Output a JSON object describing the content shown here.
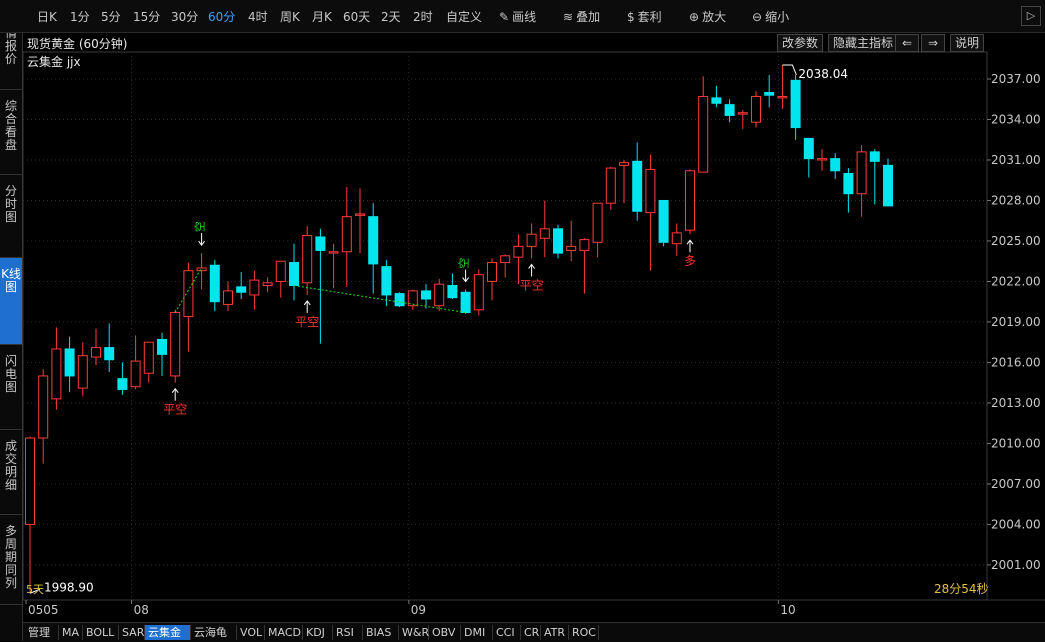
{
  "toolbar": {
    "periods": [
      "日K",
      "1分",
      "5分",
      "15分",
      "30分",
      "60分",
      "4时",
      "周K",
      "月K",
      "60天",
      "2天",
      "2时",
      "自定义"
    ],
    "active_period": "60分",
    "tools": [
      {
        "icon": "pencil-icon",
        "label": "画线"
      },
      {
        "icon": "stack-icon",
        "label": "叠加"
      },
      {
        "icon": "money-bag-icon",
        "label": "套利"
      },
      {
        "icon": "zoom-in-icon",
        "label": "放大"
      },
      {
        "icon": "zoom-out-icon",
        "label": "缩小"
      }
    ],
    "right_arrow": "▷"
  },
  "left_tabs": [
    "行情报价",
    "综合看盘",
    "分时图",
    "K线图",
    "闪电图",
    "成交明细",
    "多周期同列"
  ],
  "active_left_tab": "K线图",
  "header": {
    "title": "现货黄金 (60分钟)",
    "buttons": {
      "params": "改参数",
      "hide_indicator": "隐藏主指标",
      "prev": "⇐",
      "next": "⇒",
      "help": "说明"
    }
  },
  "indicator_title": "云集金 jjx",
  "chart_data": {
    "type": "candlestick",
    "y_ticks": [
      2037.0,
      2034.0,
      2031.0,
      2028.0,
      2025.0,
      2022.0,
      2019.0,
      2016.0,
      2013.0,
      2010.0,
      2007.0,
      2004.0,
      2001.0
    ],
    "ylim": [
      1998.4,
      2039.0
    ],
    "x_labels": [
      {
        "label": "0505",
        "i": 0
      },
      {
        "label": "08",
        "i": 8
      },
      {
        "label": "09",
        "i": 29
      },
      {
        "label": "10",
        "i": 57
      }
    ],
    "max_label": "2038.04",
    "min_label": "1998.90",
    "countdown": "28分54秒",
    "corner_label": "5天",
    "candles": [
      {
        "o": 2004.0,
        "h": 2010.5,
        "l": 1998.9,
        "c": 2010.4
      },
      {
        "o": 2010.4,
        "h": 2015.5,
        "l": 2008.5,
        "c": 2015.0
      },
      {
        "o": 2013.3,
        "h": 2018.6,
        "l": 2012.5,
        "c": 2017.0
      },
      {
        "o": 2017.0,
        "h": 2017.9,
        "l": 2013.8,
        "c": 2015.0
      },
      {
        "o": 2014.1,
        "h": 2017.5,
        "l": 2013.5,
        "c": 2016.5
      },
      {
        "o": 2016.4,
        "h": 2018.5,
        "l": 2015.8,
        "c": 2017.1
      },
      {
        "o": 2017.1,
        "h": 2018.9,
        "l": 2015.3,
        "c": 2016.2
      },
      {
        "o": 2014.8,
        "h": 2016.0,
        "l": 2013.6,
        "c": 2014.0
      },
      {
        "o": 2014.2,
        "h": 2018.0,
        "l": 2014.0,
        "c": 2016.1
      },
      {
        "o": 2015.2,
        "h": 2017.5,
        "l": 2014.5,
        "c": 2017.5
      },
      {
        "o": 2017.7,
        "h": 2018.2,
        "l": 2015.0,
        "c": 2016.6
      },
      {
        "o": 2015.0,
        "h": 2019.9,
        "l": 2014.5,
        "c": 2019.7
      },
      {
        "o": 2019.4,
        "h": 2023.4,
        "l": 2016.8,
        "c": 2022.8
      },
      {
        "o": 2022.8,
        "h": 2024.1,
        "l": 2021.4,
        "c": 2023.0
      },
      {
        "o": 2023.2,
        "h": 2023.6,
        "l": 2019.8,
        "c": 2020.5
      },
      {
        "o": 2020.3,
        "h": 2022.0,
        "l": 2019.8,
        "c": 2021.3
      },
      {
        "o": 2021.6,
        "h": 2022.7,
        "l": 2020.7,
        "c": 2021.2
      },
      {
        "o": 2021.0,
        "h": 2022.8,
        "l": 2019.9,
        "c": 2022.1
      },
      {
        "o": 2021.7,
        "h": 2022.3,
        "l": 2021.2,
        "c": 2021.9
      },
      {
        "o": 2022.0,
        "h": 2023.5,
        "l": 2020.8,
        "c": 2023.5
      },
      {
        "o": 2023.4,
        "h": 2024.8,
        "l": 2020.6,
        "c": 2021.7
      },
      {
        "o": 2021.9,
        "h": 2026.1,
        "l": 2021.0,
        "c": 2025.4
      },
      {
        "o": 2025.3,
        "h": 2025.9,
        "l": 2017.4,
        "c": 2024.3
      },
      {
        "o": 2024.1,
        "h": 2024.8,
        "l": 2021.5,
        "c": 2024.2
      },
      {
        "o": 2024.2,
        "h": 2029.0,
        "l": 2021.6,
        "c": 2026.8
      },
      {
        "o": 2026.9,
        "h": 2028.9,
        "l": 2024.1,
        "c": 2027.0
      },
      {
        "o": 2026.8,
        "h": 2027.8,
        "l": 2021.1,
        "c": 2023.3
      },
      {
        "o": 2023.1,
        "h": 2023.6,
        "l": 2020.2,
        "c": 2021.0
      },
      {
        "o": 2021.1,
        "h": 2021.2,
        "l": 2020.1,
        "c": 2020.2
      },
      {
        "o": 2020.2,
        "h": 2021.4,
        "l": 2019.9,
        "c": 2021.3
      },
      {
        "o": 2021.3,
        "h": 2021.8,
        "l": 2020.0,
        "c": 2020.7
      },
      {
        "o": 2020.2,
        "h": 2022.2,
        "l": 2019.8,
        "c": 2021.8
      },
      {
        "o": 2021.7,
        "h": 2022.6,
        "l": 2020.7,
        "c": 2020.8
      },
      {
        "o": 2021.2,
        "h": 2021.4,
        "l": 2019.6,
        "c": 2019.7
      },
      {
        "o": 2019.9,
        "h": 2022.9,
        "l": 2019.5,
        "c": 2022.5
      },
      {
        "o": 2022.0,
        "h": 2023.7,
        "l": 2020.6,
        "c": 2023.4
      },
      {
        "o": 2023.4,
        "h": 2024.0,
        "l": 2022.3,
        "c": 2023.9
      },
      {
        "o": 2023.8,
        "h": 2025.5,
        "l": 2021.8,
        "c": 2024.6
      },
      {
        "o": 2024.6,
        "h": 2026.3,
        "l": 2023.7,
        "c": 2025.5
      },
      {
        "o": 2025.2,
        "h": 2028.0,
        "l": 2023.8,
        "c": 2025.9
      },
      {
        "o": 2025.9,
        "h": 2026.2,
        "l": 2023.7,
        "c": 2024.1
      },
      {
        "o": 2024.3,
        "h": 2026.5,
        "l": 2023.5,
        "c": 2024.6
      },
      {
        "o": 2024.3,
        "h": 2025.2,
        "l": 2021.1,
        "c": 2025.1
      },
      {
        "o": 2024.9,
        "h": 2027.6,
        "l": 2023.8,
        "c": 2027.8
      },
      {
        "o": 2027.8,
        "h": 2030.5,
        "l": 2027.3,
        "c": 2030.4
      },
      {
        "o": 2030.6,
        "h": 2031.0,
        "l": 2027.8,
        "c": 2030.8
      },
      {
        "o": 2030.9,
        "h": 2032.3,
        "l": 2026.5,
        "c": 2027.2
      },
      {
        "o": 2027.1,
        "h": 2031.4,
        "l": 2022.8,
        "c": 2030.3
      },
      {
        "o": 2028.0,
        "h": 2028.0,
        "l": 2024.6,
        "c": 2024.9
      },
      {
        "o": 2024.8,
        "h": 2026.3,
        "l": 2023.9,
        "c": 2025.6
      },
      {
        "o": 2025.8,
        "h": 2030.3,
        "l": 2025.5,
        "c": 2030.2
      },
      {
        "o": 2030.1,
        "h": 2037.2,
        "l": 2030.4,
        "c": 2035.7
      },
      {
        "o": 2035.6,
        "h": 2036.5,
        "l": 2034.9,
        "c": 2035.2
      },
      {
        "o": 2035.1,
        "h": 2035.5,
        "l": 2033.8,
        "c": 2034.3
      },
      {
        "o": 2034.4,
        "h": 2034.7,
        "l": 2033.3,
        "c": 2034.5
      },
      {
        "o": 2033.8,
        "h": 2036.1,
        "l": 2033.4,
        "c": 2035.7
      },
      {
        "o": 2036.0,
        "h": 2037.3,
        "l": 2034.9,
        "c": 2035.8
      },
      {
        "o": 2035.6,
        "h": 2038.04,
        "l": 2034.8,
        "c": 2035.7
      },
      {
        "o": 2036.9,
        "h": 2037.3,
        "l": 2032.5,
        "c": 2033.4
      },
      {
        "o": 2032.6,
        "h": 2032.6,
        "l": 2029.7,
        "c": 2031.1
      },
      {
        "o": 2031.0,
        "h": 2031.8,
        "l": 2030.2,
        "c": 2031.1
      },
      {
        "o": 2031.1,
        "h": 2031.5,
        "l": 2029.6,
        "c": 2030.2
      },
      {
        "o": 2030.0,
        "h": 2030.4,
        "l": 2027.1,
        "c": 2028.5
      },
      {
        "o": 2028.5,
        "h": 2032.1,
        "l": 2026.8,
        "c": 2031.6
      },
      {
        "o": 2031.6,
        "h": 2031.8,
        "l": 2027.7,
        "c": 2030.9
      },
      {
        "o": 2030.6,
        "h": 2031.1,
        "l": 2027.6,
        "c": 2027.6
      }
    ],
    "signals": [
      {
        "i": 11,
        "label": "平空",
        "color": "#ff3030",
        "dir": "up"
      },
      {
        "i": 13,
        "label": "空",
        "color": "#20e020",
        "dir": "down",
        "vertical": true
      },
      {
        "i": 21,
        "label": "平空",
        "color": "#ff3030",
        "dir": "up"
      },
      {
        "i": 33,
        "label": "空",
        "color": "#20e020",
        "dir": "down",
        "vertical": true
      },
      {
        "i": 38,
        "label": "平空",
        "color": "#ff3030",
        "dir": "up"
      },
      {
        "i": 50,
        "label": "多",
        "color": "#ff3030",
        "dir": "up"
      }
    ]
  },
  "bottom_tabs": [
    "管理",
    "MA",
    "BOLL",
    "SAR",
    "云集金",
    "云海龟",
    "VOL",
    "MACD",
    "KDJ",
    "RSI",
    "BIAS",
    "W&R",
    "OBV",
    "DMI",
    "CCI",
    "CR",
    "ATR",
    "ROC"
  ],
  "active_bottom_tab": "云集金"
}
